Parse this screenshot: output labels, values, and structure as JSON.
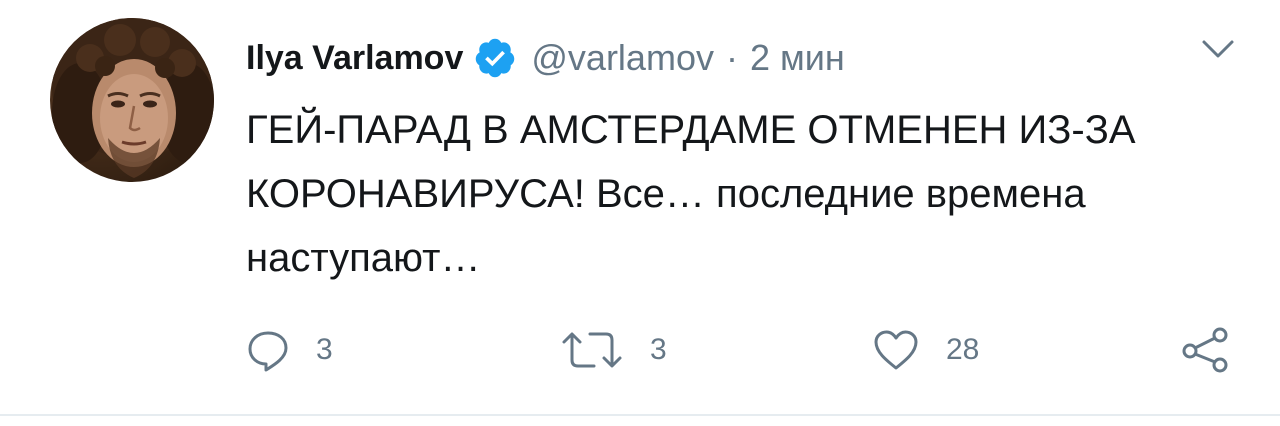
{
  "tweet": {
    "author": {
      "name": "Ilya Varlamov",
      "handle": "@varlamov",
      "verified_icon": "verified-badge-icon",
      "avatar": "avatar-photo"
    },
    "separator": "·",
    "time": "2 мин",
    "menu_icon": "chevron-down-icon",
    "text": "ГЕЙ-ПАРАД В АМСТЕРДАМЕ ОТМЕНЕН ИЗ-ЗА КОРОНАВИРУСА! Все… последние времена наступают…",
    "actions": {
      "reply": {
        "icon": "reply-icon",
        "count": "3"
      },
      "retweet": {
        "icon": "retweet-icon",
        "count": "3"
      },
      "like": {
        "icon": "heart-icon",
        "count": "28"
      },
      "share": {
        "icon": "share-icon"
      }
    },
    "colors": {
      "verified": "#1da1f2",
      "muted": "#657786",
      "text": "#14171a"
    }
  }
}
